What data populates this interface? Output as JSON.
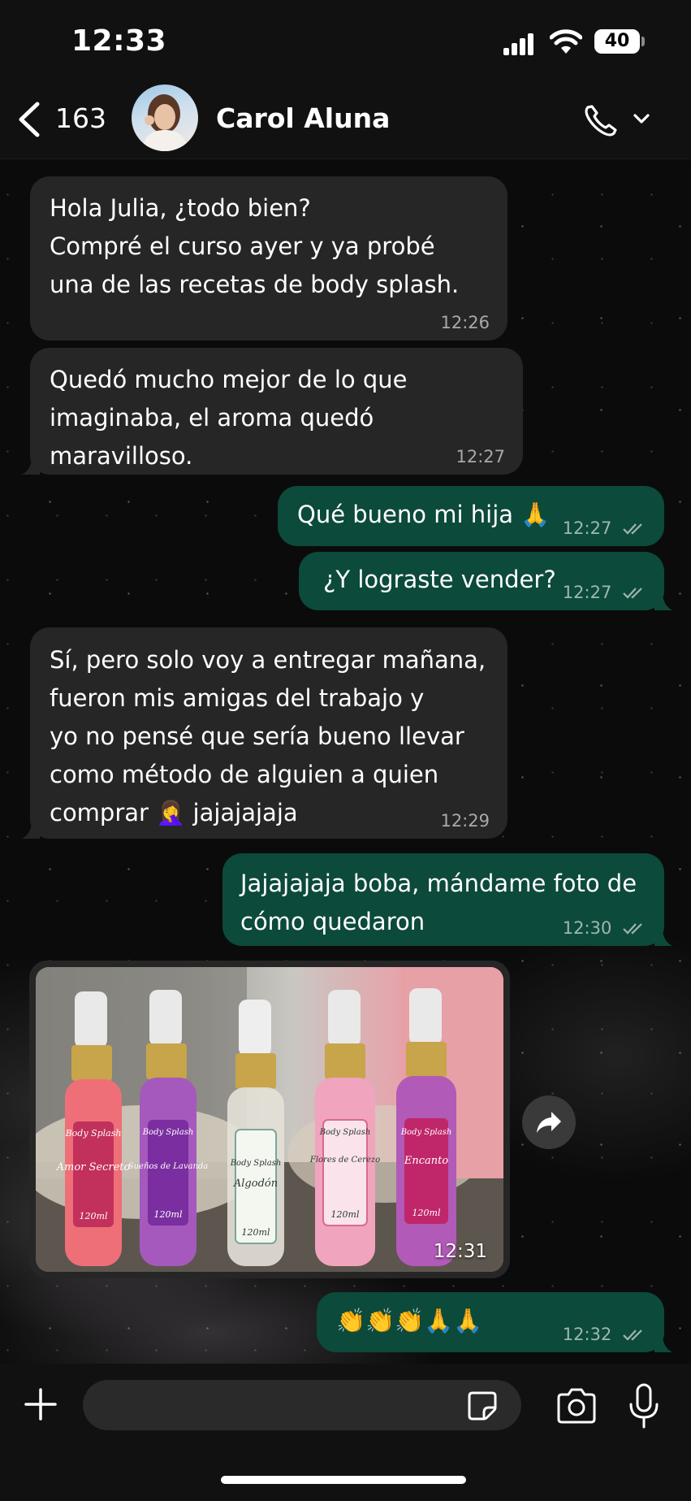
{
  "status_bar": {
    "time": "12:33",
    "battery": "40"
  },
  "header": {
    "back_count": "163",
    "contact_name": "Carol Aluna",
    "icons": [
      "back-chevron-icon",
      "avatar",
      "phone-icon",
      "chevron-down-icon"
    ]
  },
  "messages": [
    {
      "direction": "in",
      "text": "Hola Julia, ¿todo bien?\nCompré el curso ayer y ya probé\nuna de las recetas de body splash.",
      "time": "12:26"
    },
    {
      "direction": "in",
      "text": "Quedó mucho mejor de lo que\nimaginaba, el aroma quedó maravilloso.",
      "time": "12:27"
    },
    {
      "direction": "out",
      "text": "Qué bueno mi hija 🙏",
      "time": "12:27",
      "status": "read"
    },
    {
      "direction": "out",
      "text": "¿Y lograste vender?",
      "time": "12:27",
      "status": "read"
    },
    {
      "direction": "in",
      "text": "Sí, pero solo voy a entregar mañana,\nfueron mis amigas del trabajo y\nyo no pensé que sería bueno llevar\ncomo método de alguien a quien\ncomprar 🤦‍♀️ jajajajaja",
      "time": "12:29"
    },
    {
      "direction": "out",
      "text": "Jajajajaja boba, mándame foto de\ncómo quedaron",
      "time": "12:30",
      "status": "read"
    },
    {
      "direction": "in",
      "type": "photo",
      "time": "12:31",
      "labels": [
        {
          "brand": "Body Splash",
          "name": "Amor Secreto",
          "size": "120ml"
        },
        {
          "brand": "Body Splash",
          "name": "Sueños de Lavanda",
          "size": "120ml"
        },
        {
          "brand": "Body Splash",
          "name": "Algodón",
          "size": "120ml"
        },
        {
          "brand": "Body Splash",
          "name": "Flores de Cerezo",
          "size": "120ml"
        },
        {
          "brand": "Body Splash",
          "name": "Encanto",
          "size": "120ml"
        }
      ]
    },
    {
      "direction": "out",
      "text": "👏👏👏🙏🙏",
      "time": "12:32",
      "status": "read"
    }
  ],
  "input": {
    "placeholder": "",
    "icons": [
      "plus-icon",
      "sticker-icon",
      "camera-icon",
      "microphone-icon"
    ]
  },
  "colors": {
    "incoming_bubble": "#262626",
    "outgoing_bubble": "#0c4a3b",
    "bars": "#111111"
  }
}
